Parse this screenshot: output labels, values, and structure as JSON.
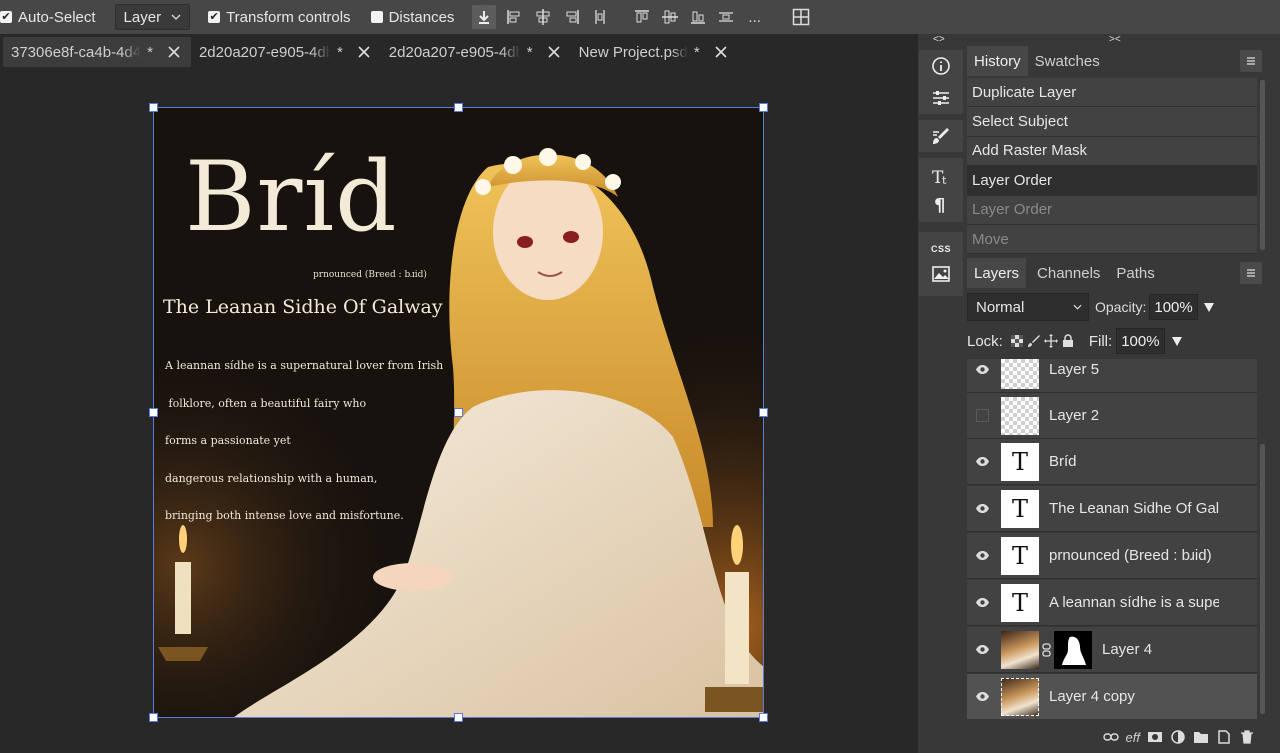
{
  "toolbar": {
    "auto_select_label": "Auto-Select",
    "auto_select_checked": true,
    "layer_select_value": "Layer",
    "transform_controls_label": "Transform controls",
    "transform_controls_checked": true,
    "distances_label": "Distances",
    "distances_checked": false,
    "more_label": "..."
  },
  "tabs": [
    {
      "name": "37306e8f-ca4b-4d4",
      "modified": "*",
      "active": true
    },
    {
      "name": "2d20a207-e905-4db",
      "modified": "*",
      "active": false
    },
    {
      "name": "2d20a207-e905-4db",
      "modified": "*",
      "active": false
    },
    {
      "name": "New Project.psd",
      "modified": "*",
      "active": false
    }
  ],
  "artwork": {
    "title": "Bríd",
    "pronunciation": "prnounced (Breed : bɹid)",
    "subtitle": "The Leanan Sidhe Of Galway",
    "body_lines": [
      "A leannan sídhe is a supernatural lover from Irish",
      " folklore, often a beautiful fairy who",
      "forms a passionate yet",
      "dangerous relationship with a human,",
      "bringing both intense love and misfortune."
    ]
  },
  "icon_column": {
    "collapse_left": "<>",
    "collapse_right": "><",
    "css_label": "CSS"
  },
  "history_panel": {
    "tabs": [
      "History",
      "Swatches"
    ],
    "items": [
      {
        "label": "Duplicate Layer",
        "state": "done"
      },
      {
        "label": "Select Subject",
        "state": "done"
      },
      {
        "label": "Add Raster Mask",
        "state": "done"
      },
      {
        "label": "Layer Order",
        "state": "current"
      },
      {
        "label": "Layer Order",
        "state": "undone"
      },
      {
        "label": "Move",
        "state": "undone"
      }
    ]
  },
  "layers_panel": {
    "tabs": [
      "Layers",
      "Channels",
      "Paths"
    ],
    "blend_mode": "Normal",
    "opacity_label": "Opacity:",
    "opacity_value": "100%",
    "lock_label": "Lock:",
    "fill_label": "Fill:",
    "fill_value": "100%",
    "layers": [
      {
        "name": "Layer 5",
        "type": "raster",
        "visible": true
      },
      {
        "name": "Layer 2",
        "type": "raster",
        "visible": false
      },
      {
        "name": "Bríd",
        "type": "text",
        "visible": true
      },
      {
        "name": "The Leanan Sidhe Of Galway",
        "type": "text",
        "visible": true
      },
      {
        "name": "prnounced (Breed : bɹid)",
        "type": "text",
        "visible": true
      },
      {
        "name": "A leannan sídhe is a supernatural lover from Irish",
        "type": "text",
        "visible": true
      },
      {
        "name": "Layer 4",
        "type": "masked-photo",
        "visible": true
      },
      {
        "name": "Layer 4 copy",
        "type": "photo",
        "visible": true,
        "selected": true
      }
    ],
    "text_thumb_glyph": "T",
    "bottom_label": "eff"
  },
  "colors": {
    "toolbar_bg": "#474747",
    "canvas_bg": "#282828",
    "panel_bg": "#383838",
    "selection": "#5a7bd8"
  }
}
